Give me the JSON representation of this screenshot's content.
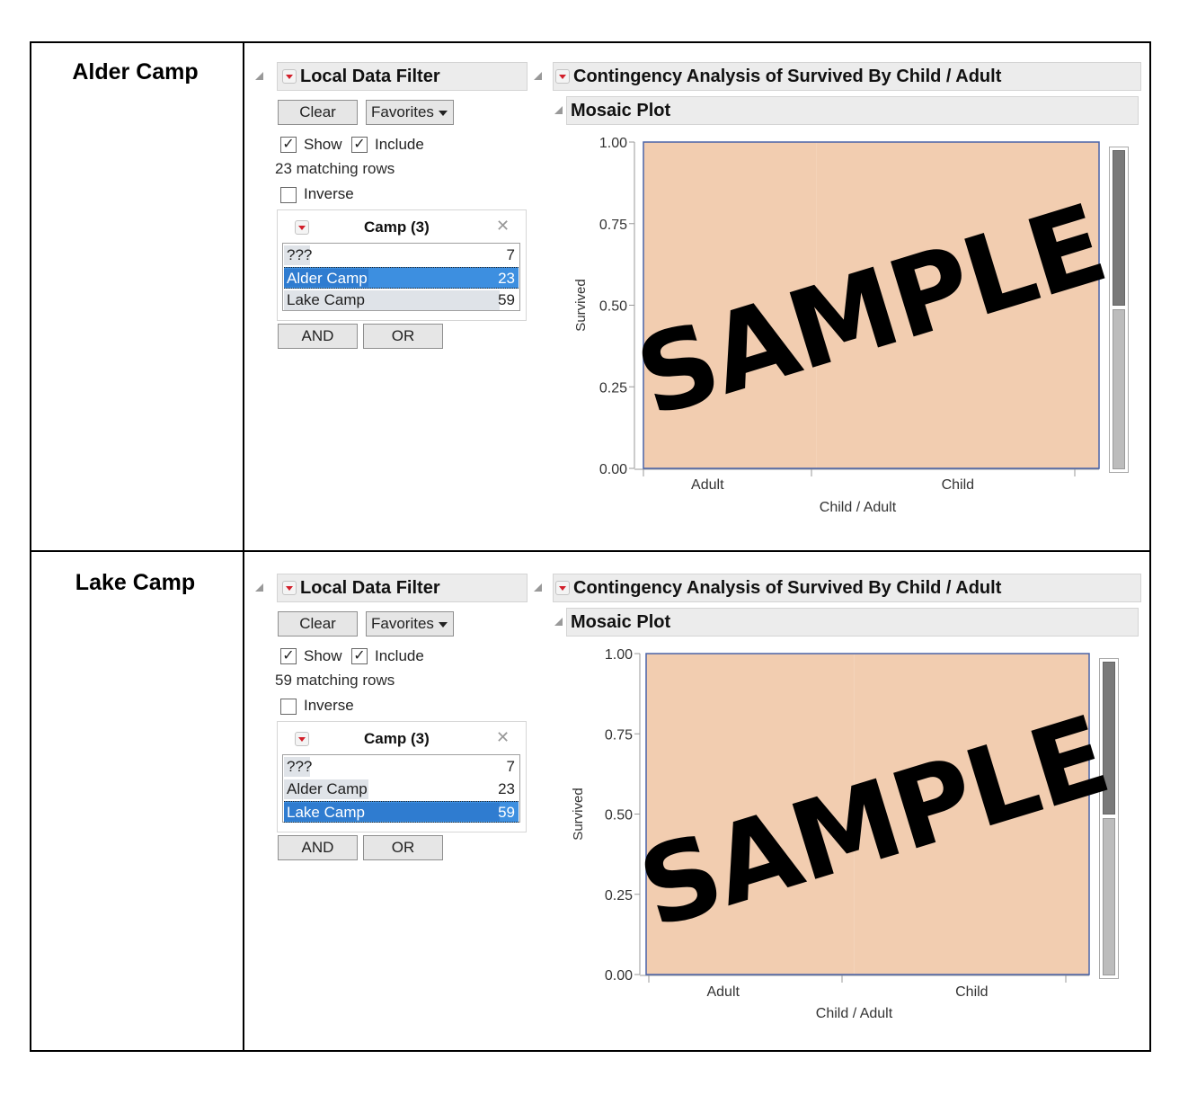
{
  "rows": [
    {
      "label": "Alder Camp",
      "filter": {
        "title": "Local Data Filter",
        "clear_label": "Clear",
        "favorites_label": "Favorites",
        "show_label": "Show",
        "show_checked": true,
        "include_label": "Include",
        "include_checked": true,
        "matching_rows": "23 matching rows",
        "inverse_label": "Inverse",
        "inverse_checked": false,
        "column_title": "Camp (3)",
        "items": [
          {
            "name": "???",
            "count": "7",
            "selected": false,
            "share": 0.12
          },
          {
            "name": "Alder Camp",
            "count": "23",
            "selected": true,
            "share": 0.39
          },
          {
            "name": "Lake Camp",
            "count": "59",
            "selected": false,
            "share": 1.0
          }
        ],
        "and_label": "AND",
        "or_label": "OR"
      },
      "analysis": {
        "title": "Contingency Analysis of Survived By Child / Adult",
        "mosaic_title": "Mosaic Plot",
        "watermark": "SAMPLE"
      }
    },
    {
      "label": "Lake Camp",
      "filter": {
        "title": "Local Data Filter",
        "clear_label": "Clear",
        "favorites_label": "Favorites",
        "show_label": "Show",
        "show_checked": true,
        "include_label": "Include",
        "include_checked": true,
        "matching_rows": "59 matching rows",
        "inverse_label": "Inverse",
        "inverse_checked": false,
        "column_title": "Camp (3)",
        "items": [
          {
            "name": "???",
            "count": "7",
            "selected": false,
            "share": 0.12
          },
          {
            "name": "Alder Camp",
            "count": "23",
            "selected": false,
            "share": 0.39
          },
          {
            "name": "Lake Camp",
            "count": "59",
            "selected": true,
            "share": 1.0
          }
        ],
        "and_label": "AND",
        "or_label": "OR"
      },
      "analysis": {
        "title": "Contingency Analysis of Survived By Child / Adult",
        "mosaic_title": "Mosaic Plot",
        "watermark": "SAMPLE"
      }
    }
  ],
  "colors": {
    "mosaic_fill": "#f2cdb0",
    "plot_border": "#4a63a8",
    "selection": "#3d8fe0",
    "menu_arrow": "#d21f2a"
  },
  "chart_data": [
    {
      "type": "bar",
      "title": "Mosaic Plot",
      "xlabel": "Child / Adult",
      "ylabel": "Survived",
      "categories": [
        "Adult",
        "Child"
      ],
      "category_widths": [
        0.38,
        0.62
      ],
      "series": [
        {
          "name": "Survived",
          "values": [
            1.0,
            1.0
          ]
        }
      ],
      "yticks": [
        "0.00",
        "0.25",
        "0.50",
        "0.75",
        "1.00"
      ],
      "ylim": [
        0,
        1
      ],
      "legend": "none",
      "annotation": "SAMPLE"
    },
    {
      "type": "bar",
      "title": "Mosaic Plot",
      "xlabel": "Child / Adult",
      "ylabel": "Survived",
      "categories": [
        "Adult",
        "Child"
      ],
      "category_widths": [
        0.47,
        0.53
      ],
      "series": [
        {
          "name": "Survived",
          "values": [
            1.0,
            1.0
          ]
        }
      ],
      "yticks": [
        "0.00",
        "0.25",
        "0.50",
        "0.75",
        "1.00"
      ],
      "ylim": [
        0,
        1
      ],
      "legend": "none",
      "annotation": "SAMPLE"
    }
  ]
}
